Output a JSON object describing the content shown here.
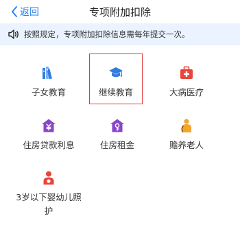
{
  "header": {
    "back_label": "返回",
    "title": "专项附加扣除"
  },
  "notice": {
    "text": "按照规定，专项附加扣除信息需每年提交一次。"
  },
  "items": [
    {
      "label": "子女教育",
      "icon": "books-icon",
      "color": "#2f7de0"
    },
    {
      "label": "继续教育",
      "icon": "graduation-cap-icon",
      "color": "#2f7de0",
      "selected": true
    },
    {
      "label": "大病医疗",
      "icon": "medical-kit-icon",
      "color": "#e9443a"
    },
    {
      "label": "住房贷款利息",
      "icon": "house-loan-icon",
      "color": "#8a45c9"
    },
    {
      "label": "住房租金",
      "icon": "house-rent-icon",
      "color": "#8a45c9"
    },
    {
      "label": "赡养老人",
      "icon": "elder-icon",
      "color": "#f4a52c"
    },
    {
      "label": "3岁以下婴幼儿照护",
      "icon": "baby-care-icon",
      "color": "#e9443a"
    }
  ],
  "colors": {
    "accent": "#1f7ef0",
    "notice_bg": "#eaf3ff",
    "selection_border": "#e33b35"
  }
}
